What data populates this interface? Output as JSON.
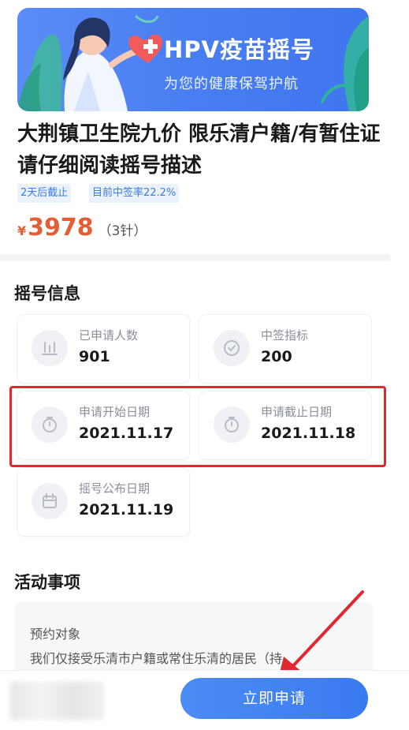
{
  "banner": {
    "title": "HPV疫苗摇号",
    "subtitle": "为您的健康保驾护航"
  },
  "product": {
    "title": "大荆镇卫生院九价 限乐清户籍/有暂住证 请仔细阅读摇号描述",
    "tags": [
      "2天后截止",
      "目前中签率22.2%"
    ],
    "price_currency": "¥",
    "price": "3978",
    "price_note": "（3针）"
  },
  "lottery_info": {
    "section_title": "摇号信息",
    "cards": [
      {
        "label": "已申请人数",
        "value": "901",
        "icon": "bar-chart-icon"
      },
      {
        "label": "中签指标",
        "value": "200",
        "icon": "check-circle-icon"
      },
      {
        "label": "申请开始日期",
        "value": "2021.11.17",
        "icon": "stopwatch-icon"
      },
      {
        "label": "申请截止日期",
        "value": "2021.11.18",
        "icon": "stopwatch-icon"
      },
      {
        "label": "摇号公布日期",
        "value": "2021.11.19",
        "icon": "calendar-icon"
      }
    ]
  },
  "activity": {
    "section_title": "活动事项",
    "label": "预约对象",
    "text": "我们仅接受乐清市户籍或常住乐清的居民（持"
  },
  "bottom": {
    "apply_button": "立即申请"
  },
  "colors": {
    "accent": "#3d7bea",
    "price": "#e35e33",
    "highlight_border": "#e0282e"
  }
}
